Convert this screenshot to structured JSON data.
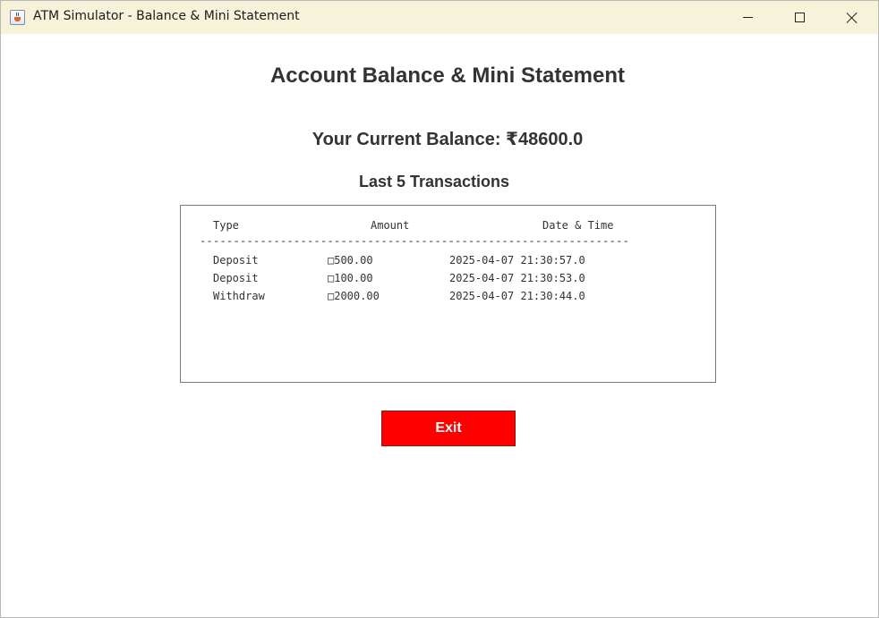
{
  "window": {
    "title": "ATM Simulator - Balance & Mini Statement",
    "icon": "java-coffee-cup-icon",
    "controls": {
      "minimize_icon": "minimize-icon",
      "maximize_icon": "maximize-icon",
      "close_icon": "close-icon"
    }
  },
  "main": {
    "heading": "Account Balance & Mini Statement",
    "balance_text": "Your Current Balance: ₹48600.0",
    "transactions_heading": "Last 5 Transactions"
  },
  "statement": {
    "headers": {
      "type": "Type",
      "amount": "Amount",
      "datetime": "Date & Time"
    },
    "divider": "----------------------------------------------------------------",
    "rows": [
      {
        "type": "Deposit",
        "amount": "□500.00",
        "datetime": "2025-04-07 21:30:57.0"
      },
      {
        "type": "Deposit",
        "amount": "□100.00",
        "datetime": "2025-04-07 21:30:53.0"
      },
      {
        "type": "Withdraw",
        "amount": "□2000.00",
        "datetime": "2025-04-07 21:30:44.0"
      }
    ]
  },
  "actions": {
    "exit_label": "Exit"
  },
  "colors": {
    "titlebar": "#f7f3da",
    "exit_button": "#ff0000",
    "text": "#333333"
  }
}
